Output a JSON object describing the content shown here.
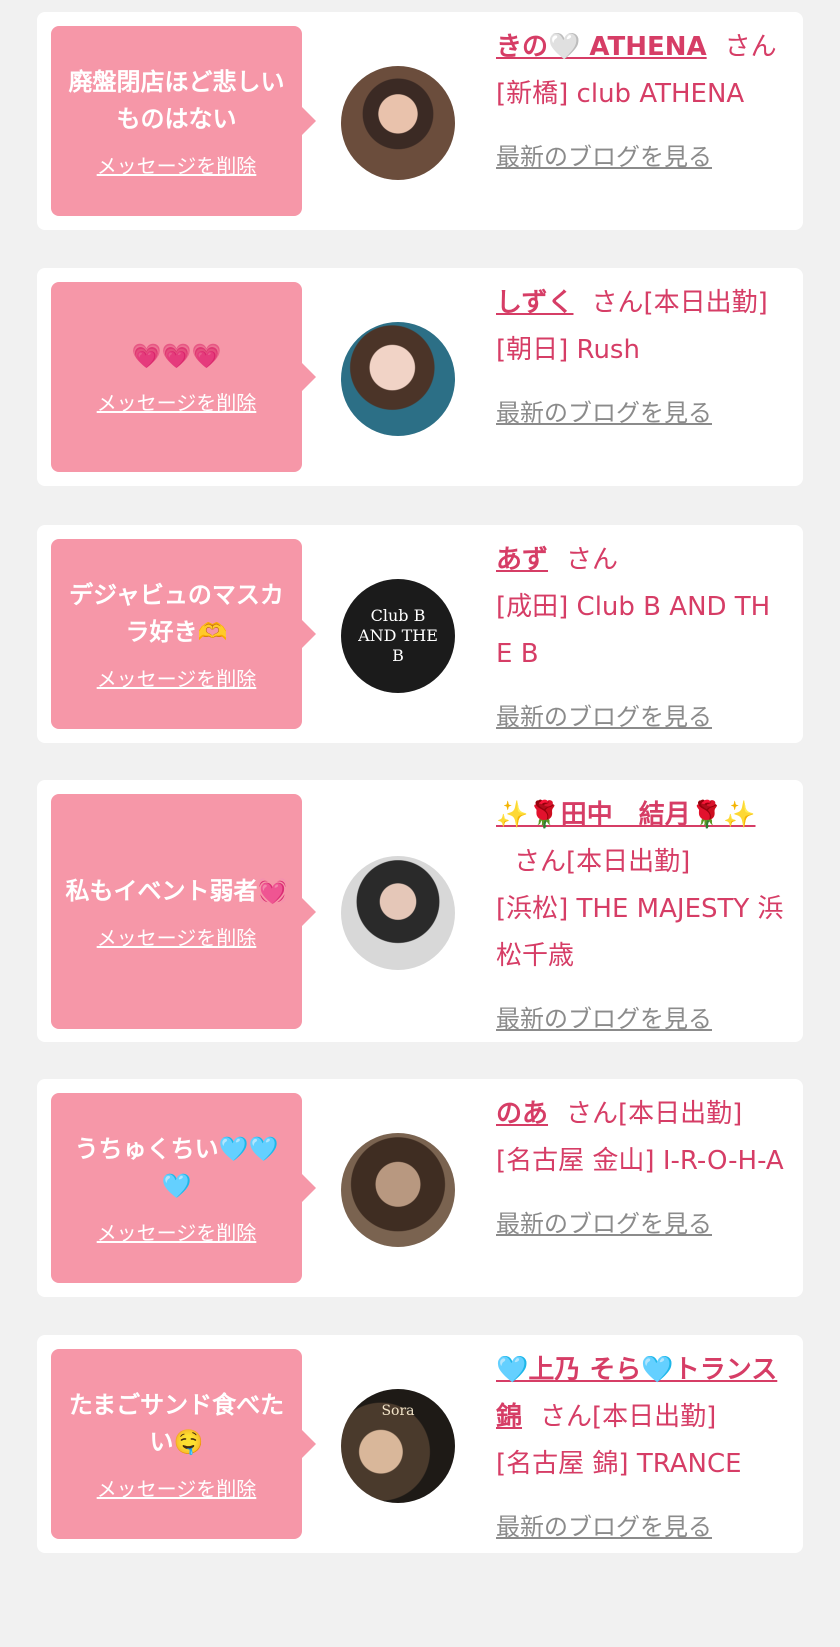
{
  "delete_label": "メッセージを削除",
  "blog_label": "最新のブログを見る",
  "cards": [
    {
      "message": "廃盤閉店ほど悲しいものはない",
      "name": "きの🤍 ATHENA",
      "suffix": "さん",
      "shop": "[新橋] club ATHENA"
    },
    {
      "message": "💗💗💗",
      "name": "しずく",
      "suffix": "さん[本日出勤]",
      "shop": "[朝日] Rush"
    },
    {
      "message": "デジャビュのマスカラ好き🫶",
      "name": "あず",
      "suffix": "さん",
      "shop": "[成田] Club B AND THE B",
      "avatar_text": "Club B AND THE B"
    },
    {
      "message": "私もイベント弱者💓",
      "name": "✨🌹田中　結月🌹✨",
      "suffix": "さん[本日出勤]",
      "shop": "[浜松] THE MAJESTY 浜松千歳"
    },
    {
      "message": "うちゅくちい🩵🩵🩵",
      "name": "のあ",
      "suffix": "さん[本日出勤]",
      "shop": "[名古屋 金山] I-R-O-H-A"
    },
    {
      "message": "たまごサンド食べたい🤤",
      "name": "🩵上乃 そら🩵トランス 錦",
      "suffix": "さん[本日出勤]",
      "shop": "[名古屋 錦] TRANCE",
      "avatar_text": "Sora"
    }
  ],
  "colors": {
    "bubble": "#f697a8",
    "name": "#d63d66",
    "link_gray": "#8b8b8b",
    "background": "#f1f1f1"
  }
}
